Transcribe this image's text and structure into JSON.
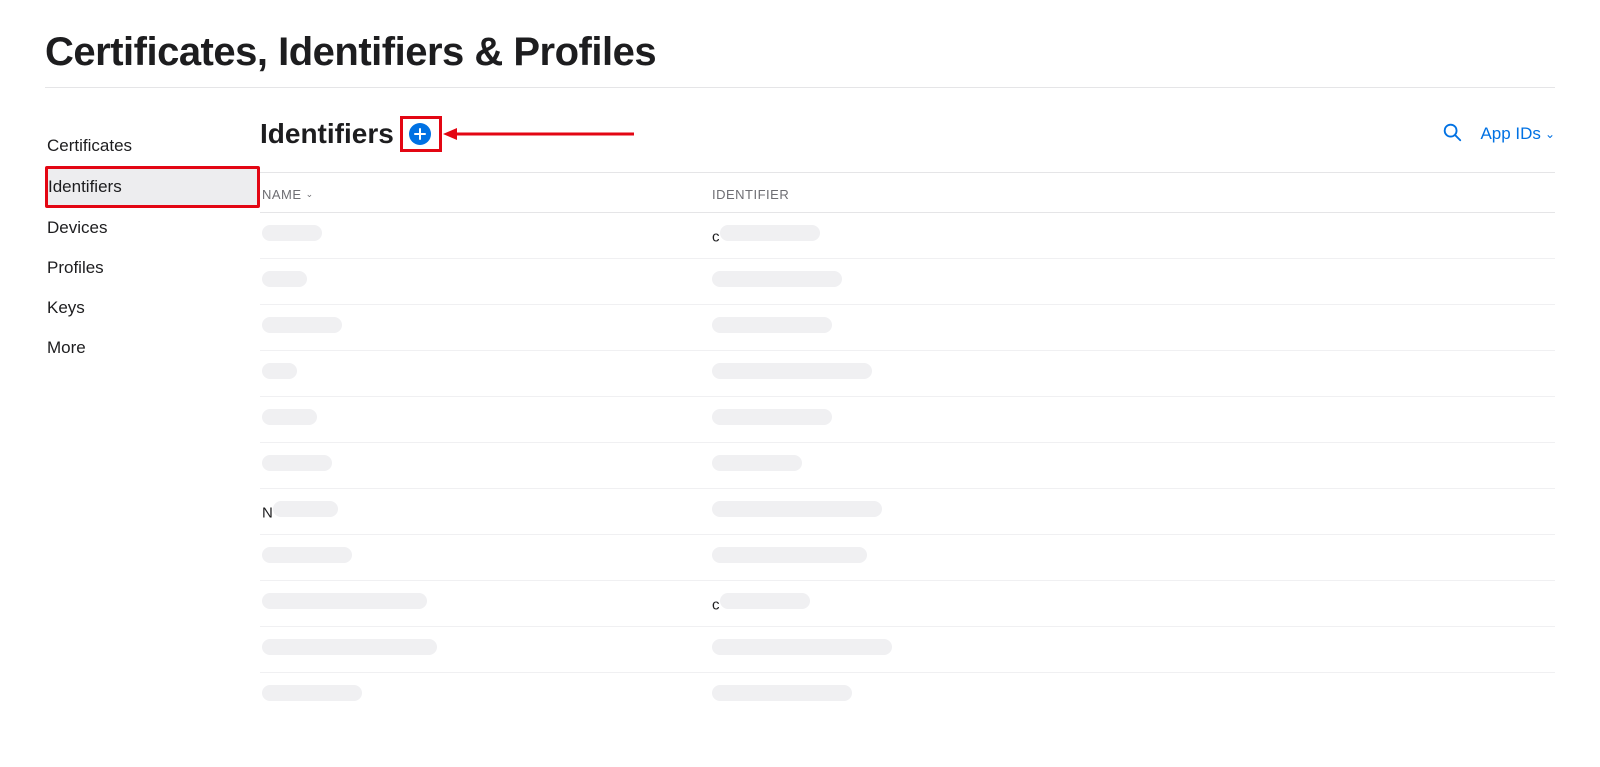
{
  "pageTitle": "Certificates, Identifiers & Profiles",
  "sidebar": {
    "items": [
      {
        "label": "Certificates",
        "active": false
      },
      {
        "label": "Identifiers",
        "active": true
      },
      {
        "label": "Devices",
        "active": false
      },
      {
        "label": "Profiles",
        "active": false
      },
      {
        "label": "Keys",
        "active": false
      },
      {
        "label": "More",
        "active": false
      }
    ]
  },
  "main": {
    "sectionTitle": "Identifiers",
    "filterLabel": "App IDs",
    "columns": {
      "name": "NAME",
      "identifier": "IDENTIFIER"
    },
    "rows": [
      {
        "namePrefix": "",
        "nameW": 60,
        "idPrefix": "c",
        "idW": 100
      },
      {
        "namePrefix": "",
        "nameW": 45,
        "idPrefix": "",
        "idW": 130
      },
      {
        "namePrefix": "",
        "nameW": 80,
        "idPrefix": "",
        "idW": 120
      },
      {
        "namePrefix": "",
        "nameW": 35,
        "idPrefix": "",
        "idW": 160
      },
      {
        "namePrefix": "",
        "nameW": 55,
        "idPrefix": "",
        "idW": 120
      },
      {
        "namePrefix": "",
        "nameW": 70,
        "idPrefix": "",
        "idW": 90
      },
      {
        "namePrefix": "N",
        "nameW": 65,
        "idPrefix": "",
        "idW": 170
      },
      {
        "namePrefix": "",
        "nameW": 90,
        "idPrefix": "",
        "idW": 155
      },
      {
        "namePrefix": "",
        "nameW": 165,
        "idPrefix": "c",
        "idW": 90
      },
      {
        "namePrefix": "",
        "nameW": 175,
        "idPrefix": "",
        "idW": 180
      },
      {
        "namePrefix": "",
        "nameW": 100,
        "idPrefix": "",
        "idW": 140
      },
      {
        "namePrefix": "",
        "nameW": 80,
        "idPrefix": "",
        "idW": 120
      }
    ]
  },
  "colors": {
    "accent": "#0071e3",
    "annotation": "#e30613"
  }
}
